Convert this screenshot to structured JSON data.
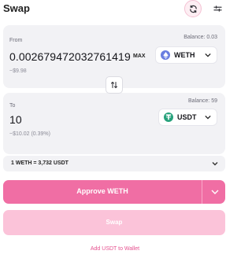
{
  "header": {
    "title": "Swap"
  },
  "from": {
    "label": "From",
    "balance": "Balance: 0.03",
    "amount": "0.002679472032761419",
    "usd_value": "~$9.98",
    "max_label": "MAX",
    "token": "WETH"
  },
  "to": {
    "label": "To",
    "balance": "Balance: 59",
    "amount": "10",
    "usd_value": "~$10.02 (0.39%)",
    "token": "USDT"
  },
  "rate": {
    "text": "1 WETH = 3,732 USDT"
  },
  "actions": {
    "approve_label": "Approve WETH",
    "swap_label": "Swap",
    "add_token_link": "Add USDT to Wallet"
  },
  "colors": {
    "accent": "#f06ea4",
    "accent_light": "#fbc3d9",
    "weth_icon": "#6a7ee0",
    "usdt_icon": "#26a17b"
  },
  "icons": {
    "refresh": "refresh-icon",
    "settings": "settings-sliders-icon",
    "swap_direction": "swap-arrows-icon",
    "chevron": "chevron-down-icon"
  }
}
